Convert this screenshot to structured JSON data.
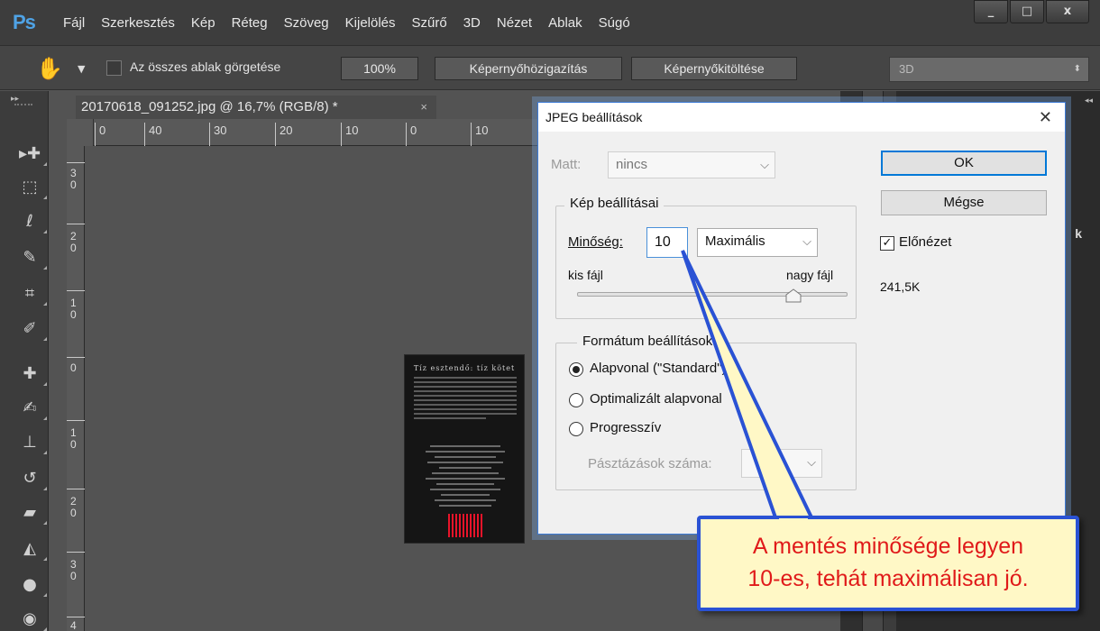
{
  "app": {
    "logo": "Ps",
    "menu": [
      "Fájl",
      "Szerkesztés",
      "Kép",
      "Réteg",
      "Szöveg",
      "Kijelölés",
      "Szűrő",
      "3D",
      "Nézet",
      "Ablak",
      "Súgó"
    ],
    "window_controls": {
      "minimize": "_",
      "maximize": "□",
      "close": "x"
    }
  },
  "options_bar": {
    "scroll_all_label": "Az összes ablak görgetése",
    "zoom_100": "100%",
    "fit_screen": "Képernyőhözigazítás",
    "fill_screen": "Képernyőkitöltése",
    "workspace": "3D"
  },
  "document": {
    "tab_title": "20170618_091252.jpg @ 16,7% (RGB/8) *",
    "tab_close": "×",
    "ruler_h": [
      "0",
      "40",
      "30",
      "20",
      "10",
      "0",
      "10"
    ],
    "ruler_v": [
      "3\n0",
      "2\n0",
      "1\n0",
      "0",
      "1\n0",
      "2\n0",
      "3\n0",
      "4"
    ],
    "book_title": "Tíz esztendő: tíz kötet"
  },
  "right_panel": {
    "peek_text": "k"
  },
  "dialog": {
    "title": "JPEG beállítások",
    "close": "✕",
    "matte_label": "Matt:",
    "matte_value": "nincs",
    "image_group": "Kép beállításai",
    "quality_label": "Minőség:",
    "quality_value": "10",
    "quality_preset": "Maximális",
    "slider_min_label": "kis fájl",
    "slider_max_label": "nagy fájl",
    "quality_slider": {
      "min": 0,
      "max": 12,
      "value": 10
    },
    "format_group": "Formátum beállítások",
    "radio_baseline": "Alapvonal (\"Standard\")",
    "radio_optimized": "Optimalizált alapvonal",
    "radio_progressive": "Progresszív",
    "scans_label": "Pásztázások száma:",
    "ok": "OK",
    "cancel": "Mégse",
    "preview_label": "Előnézet",
    "preview_checked": true,
    "file_size": "241,5K"
  },
  "callout": {
    "line1": "A mentés minősége legyen",
    "line2": "10-es, tehát maximálisan jó."
  },
  "colors": {
    "callout_border": "#2a52d4",
    "callout_text": "#e01a1a",
    "callout_bg": "#fff8c6",
    "ps_blue": "#4fa3e6"
  }
}
